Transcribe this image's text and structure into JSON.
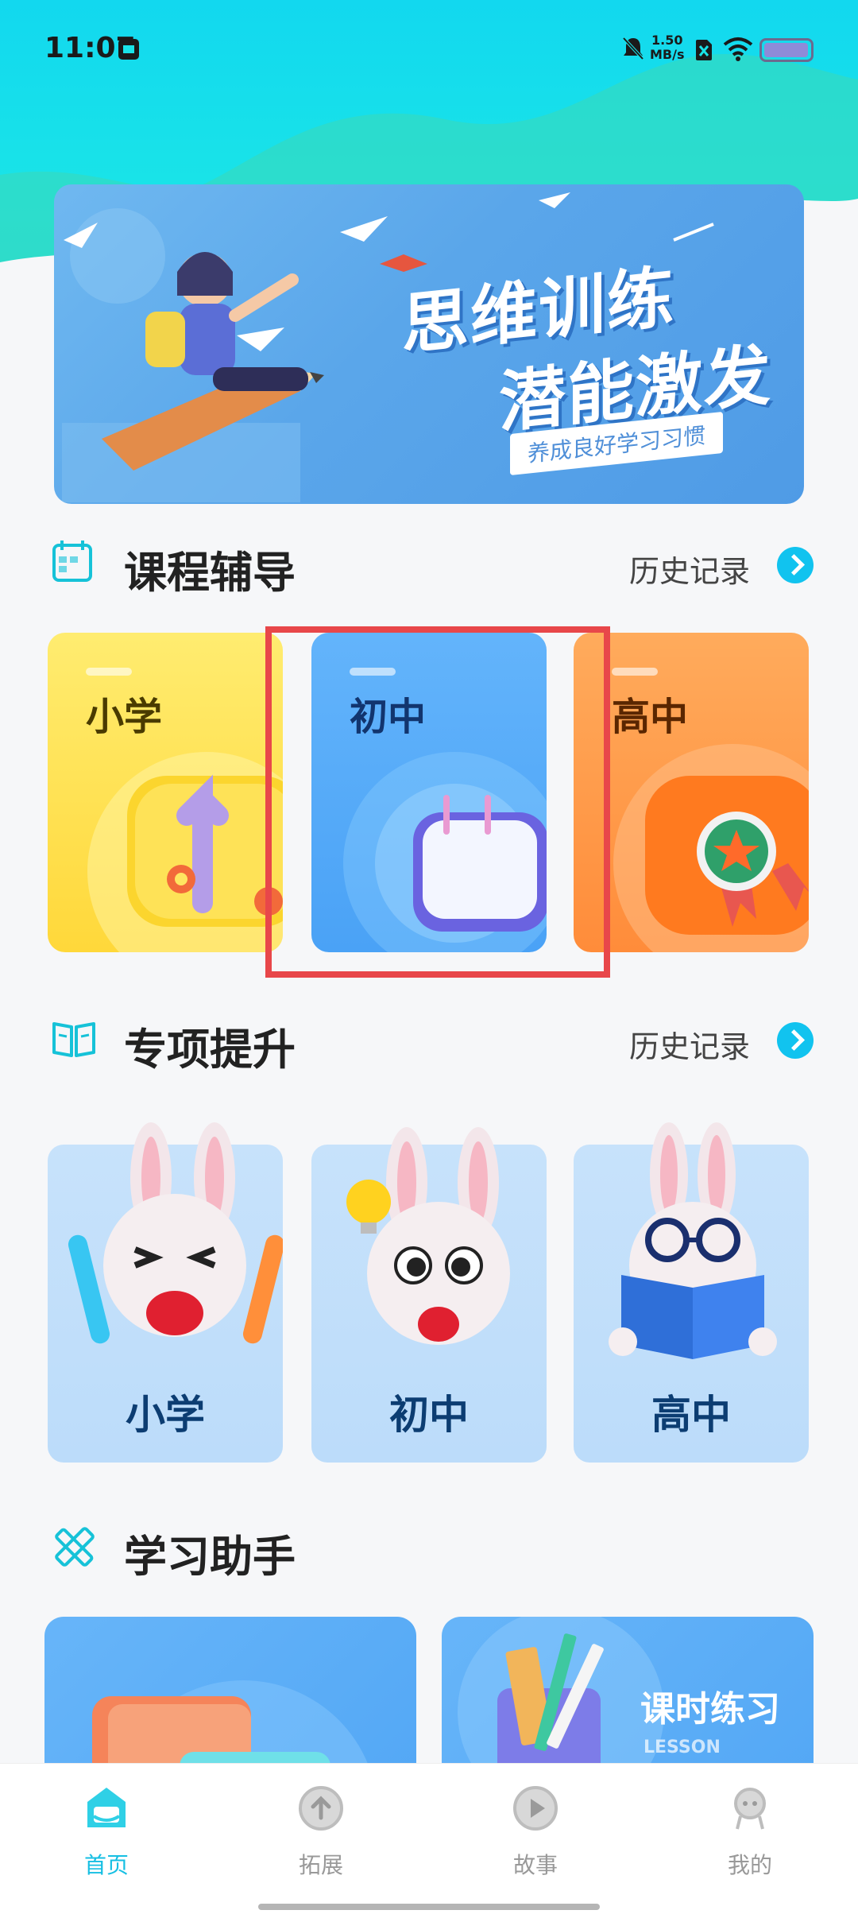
{
  "status_bar": {
    "time": "11:07",
    "net_speed_value": "1.50",
    "net_speed_unit": "MB/s"
  },
  "banner": {
    "title_line1": "思维训练",
    "title_line2": "潜能激发",
    "subtitle": "养成良好学习习惯"
  },
  "course_section": {
    "title": "课程辅导",
    "history_label": "历史记录",
    "cards": [
      {
        "label": "小学"
      },
      {
        "label": "初中"
      },
      {
        "label": "高中"
      }
    ]
  },
  "special_section": {
    "title": "专项提升",
    "history_label": "历史记录",
    "cards": [
      {
        "label": "小学"
      },
      {
        "label": "初中"
      },
      {
        "label": "高中"
      }
    ]
  },
  "assistant_section": {
    "title": "学习助手",
    "cards": [
      {
        "title": "",
        "subtitle": ""
      },
      {
        "title": "课时练习",
        "subtitle": "LESSON"
      }
    ]
  },
  "tabbar": {
    "items": [
      {
        "label": "首页",
        "icon": "home-icon",
        "active": true
      },
      {
        "label": "拓展",
        "icon": "expand-icon",
        "active": false
      },
      {
        "label": "故事",
        "icon": "story-play-icon",
        "active": false
      },
      {
        "label": "我的",
        "icon": "profile-icon",
        "active": false
      }
    ]
  },
  "colors": {
    "accent": "#16bfe3",
    "highlight_box": "#e8474a"
  }
}
